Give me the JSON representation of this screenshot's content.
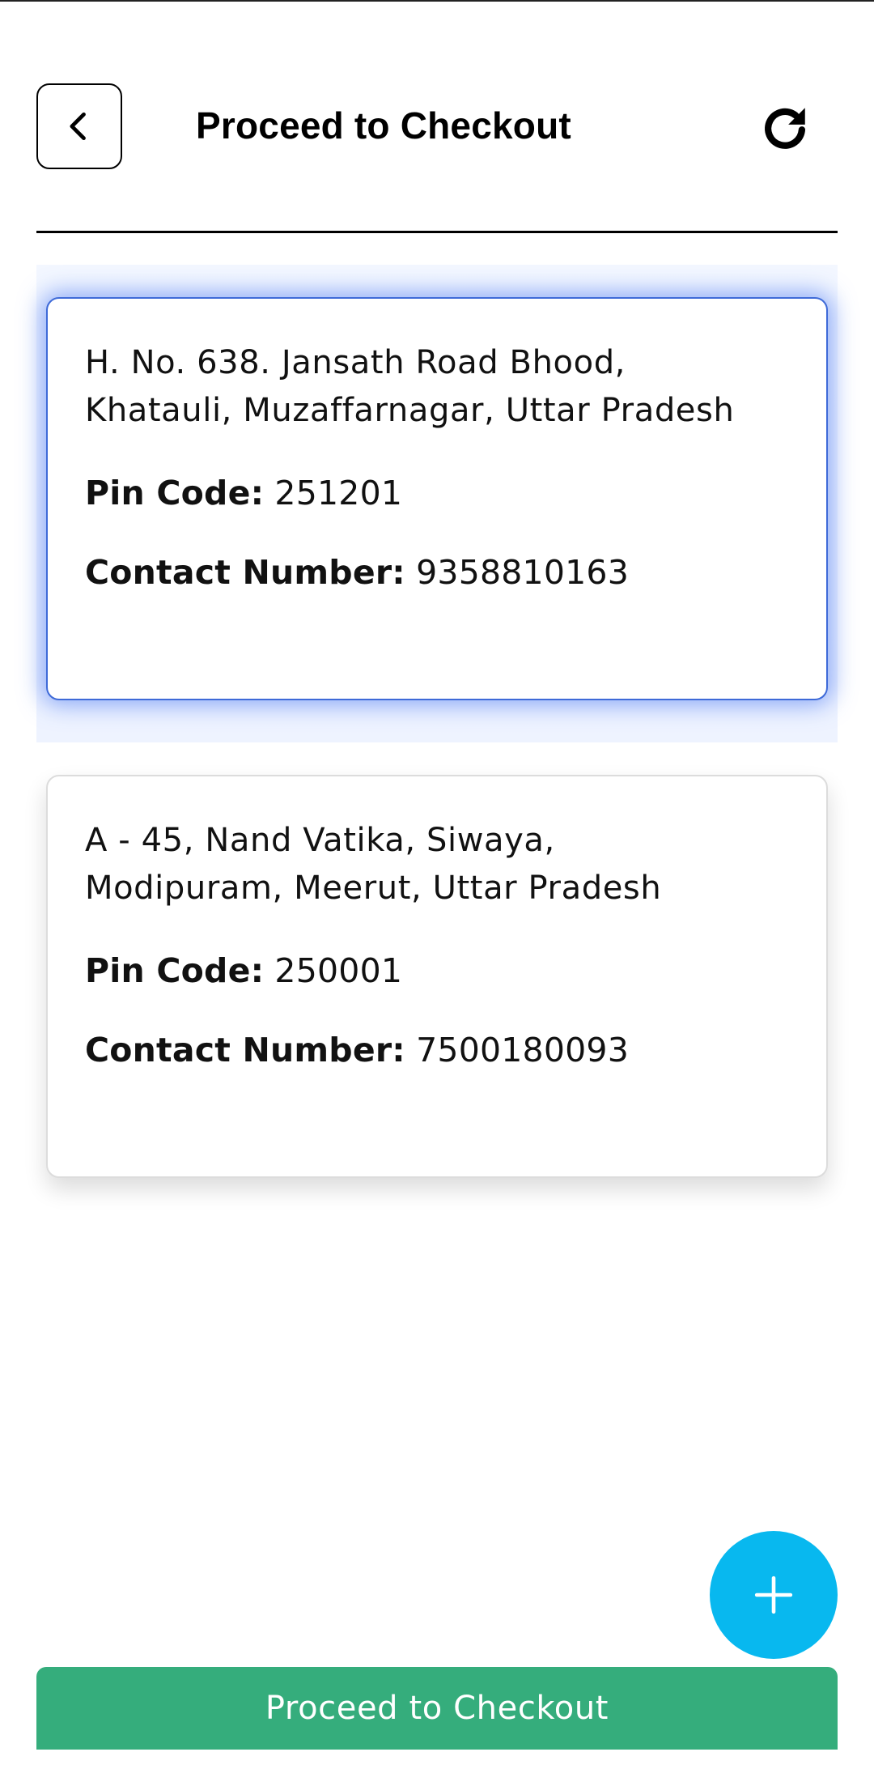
{
  "header": {
    "title": "Proceed to Checkout",
    "back_icon": "chevron-left-icon",
    "refresh_icon": "refresh-icon"
  },
  "addresses": [
    {
      "address_line1": "H. No. 638. Jansath Road Bhood,",
      "address_line2": "Khatauli, Muzaffarnagar, Uttar Pradesh",
      "pin_label": "Pin Code:",
      "pin_value": "251201",
      "contact_label": "Contact Number:",
      "contact_value": "9358810163",
      "selected": true
    },
    {
      "address_line1": "A - 45, Nand Vatika, Siwaya,",
      "address_line2": "Modipuram, Meerut, Uttar Pradesh",
      "pin_label": "Pin Code:",
      "pin_value": "250001",
      "contact_label": "Contact Number:",
      "contact_value": "7500180093",
      "selected": false
    }
  ],
  "fab": {
    "icon": "plus-icon"
  },
  "footer": {
    "checkout_label": "Proceed to Checkout"
  },
  "colors": {
    "selected_border": "#3e6ad8",
    "fab": "#08b8ef",
    "checkout_button": "#35ad7c"
  }
}
